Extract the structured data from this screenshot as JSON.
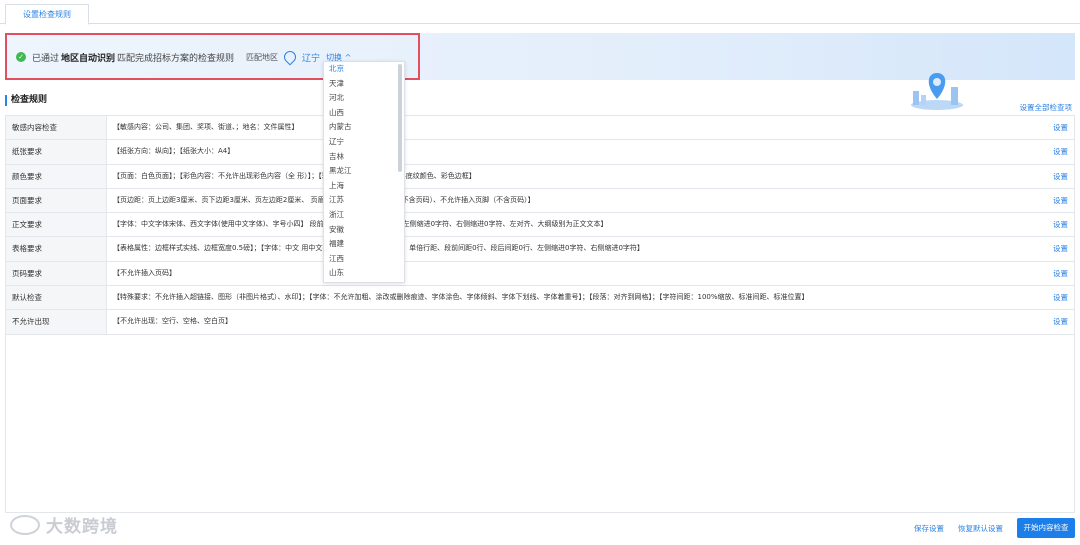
{
  "tab": {
    "label": "设置检查规则"
  },
  "banner": {
    "status_prefix": "已通过",
    "status_bold": "地区自动识别",
    "status_suffix": "匹配完成招标方案的检查规则",
    "region_label": "匹配地区",
    "region_value": "辽宁",
    "switch_label": "切换 ^"
  },
  "dropdown": {
    "options": [
      "北京",
      "天津",
      "河北",
      "山西",
      "内蒙古",
      "辽宁",
      "吉林",
      "黑龙江",
      "上海",
      "江苏",
      "浙江",
      "安徽",
      "福建",
      "江西",
      "山东"
    ],
    "selected": "北京"
  },
  "section": {
    "title": "检查规则",
    "set_all": "设置全部检查项"
  },
  "rules": [
    {
      "name": "敏感内容检查",
      "content": "【敏感内容：公司、集团、奖项、街道、；地名：文件属性】",
      "action": "设置"
    },
    {
      "name": "纸张要求",
      "content": "【纸张方向：纵向】；【纸张大小：A4】",
      "action": "设置"
    },
    {
      "name": "颜色要求",
      "content": "【页面：白色页面】；【彩色内容：不允许出现彩色内容（全                                          形）】；【彩色表格：不允许设置表格底纹颜色、彩色边框】",
      "action": "设置"
    },
    {
      "name": "页面要求",
      "content": "【页边距：页上边距3厘米、页下边距3厘米、页左边距2厘米、                                          页眉页脚：不允许插入页眉（不含页码）、不允许插入页脚（不含页码）】",
      "action": "设置"
    },
    {
      "name": "正文要求",
      "content": "【字体：中文字体宋体、西文字体(使用中文字体)、字号小四】                                          段前间距0行、段后间距0行、左侧缩进0字符、右侧缩进0字符、左对齐、大纲级别为正文文本】",
      "action": "设置"
    },
    {
      "name": "表格要求",
      "content": "【表格属性：边框样式实线、边框宽度0.5磅】；【字体：中文                                          用中文字体)、字号小四】；【段落：单倍行距、段前间距0行、段后间距0行、左侧缩进0字符、右侧缩进0字符】",
      "action": "设置"
    },
    {
      "name": "页码要求",
      "content": "【不允许插入页码】",
      "action": "设置"
    },
    {
      "name": "默认检查",
      "content": "【特殊要求：不允许插入超链接、图形（非图片格式）、水印】；【字体：不允许加粗、涂改或删除痕迹、字体涂色、字体倾斜、字体下划线、字体着重号】；【段落：对齐到网格】；【字符间距：100%缩放、标准间距、标准位置】",
      "action": "设置"
    },
    {
      "name": "不允许出现",
      "content": "【不允许出现：空行、空格、空白页】",
      "action": "设置"
    }
  ],
  "footer": {
    "watermark": "大数跨境",
    "save": "保存设置",
    "restore": "恢复默认设置",
    "start": "开始内容检查"
  },
  "colors": {
    "accent": "#2a82e4",
    "highlight": "#e0505f",
    "success": "#3fb950"
  }
}
